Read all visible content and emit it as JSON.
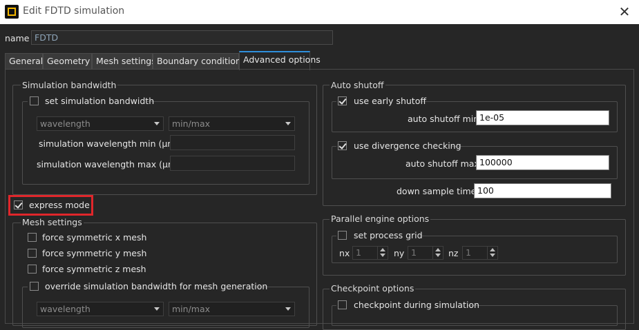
{
  "window": {
    "title": "Edit FDTD simulation",
    "close": "✕"
  },
  "name": {
    "label": "name",
    "value": "FDTD"
  },
  "tabs": [
    {
      "label": "General"
    },
    {
      "label": "Geometry"
    },
    {
      "label": "Mesh settings"
    },
    {
      "label": "Boundary conditions"
    },
    {
      "label": "Advanced options"
    }
  ],
  "simulation_bandwidth": {
    "title": "Simulation bandwidth",
    "set_label": "set simulation bandwidth",
    "type_select": "wavelength",
    "range_select": "min/max",
    "wl_min_label": "simulation wavelength min (μm)",
    "wl_max_label": "simulation wavelength max (μm)"
  },
  "express_mode": {
    "label": "express mode"
  },
  "mesh_settings": {
    "title": "Mesh settings",
    "sym_x": "force symmetric x mesh",
    "sym_y": "force symmetric y mesh",
    "sym_z": "force symmetric z mesh",
    "override_label": "override simulation bandwidth for mesh generation",
    "type_select": "wavelength",
    "range_select": "min/max"
  },
  "auto_shutoff": {
    "title": "Auto shutoff",
    "early_label": "use early shutoff",
    "min_label": "auto shutoff min",
    "min_value": "1e-05",
    "divergence_label": "use divergence checking",
    "max_label": "auto shutoff max",
    "max_value": "100000",
    "down_sample_label": "down sample time",
    "down_sample_value": "100"
  },
  "parallel": {
    "title": "Parallel engine options",
    "grid_label": "set process grid",
    "nx_label": "nx",
    "nx_value": "1",
    "ny_label": "ny",
    "ny_value": "1",
    "nz_label": "nz",
    "nz_value": "1"
  },
  "checkpoint": {
    "title": "Checkpoint options",
    "during_label": "checkpoint during simulation"
  }
}
